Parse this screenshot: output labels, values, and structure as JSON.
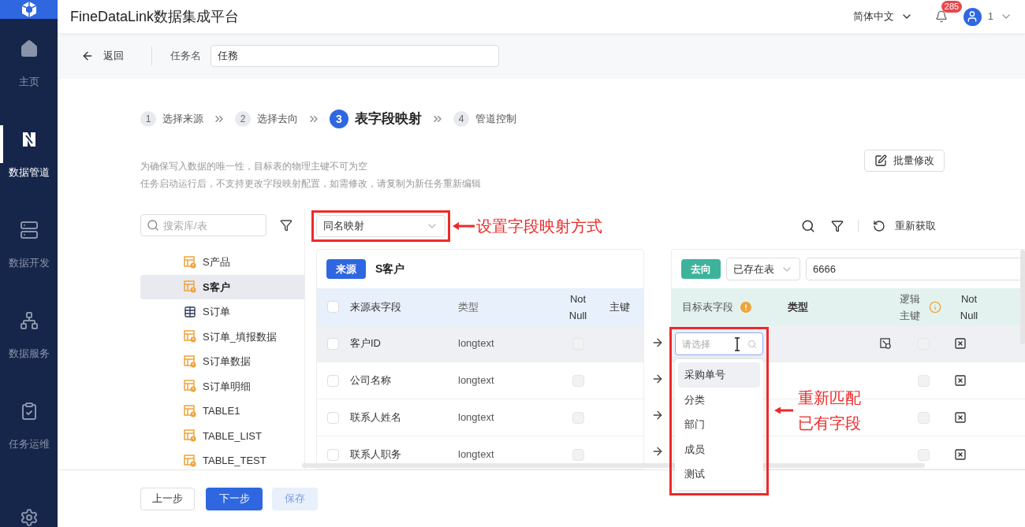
{
  "app": {
    "title": "FineDataLink数据集成平台"
  },
  "nav": [
    {
      "label": "主页",
      "selected": false,
      "kind": "home"
    },
    {
      "label": "数据管道",
      "selected": true,
      "kind": "pipeline"
    },
    {
      "label": "数据开发",
      "selected": false,
      "kind": "dev"
    },
    {
      "label": "数据服务",
      "selected": false,
      "kind": "service"
    },
    {
      "label": "任务运维",
      "selected": false,
      "kind": "ops"
    },
    {
      "selected": false,
      "kind": "settings"
    }
  ],
  "header": {
    "language": "简体中文",
    "notifications": "285",
    "user": "1"
  },
  "task": {
    "back": "返回",
    "name_label": "任务名",
    "name_value": "任務"
  },
  "steps": [
    {
      "number": "1",
      "label": "选择来源",
      "selected": false
    },
    {
      "number": "2",
      "label": "选择去向",
      "selected": false
    },
    {
      "number": "3",
      "label": "表字段映射",
      "selected": true
    },
    {
      "number": "4",
      "label": "管道控制",
      "selected": false
    }
  ],
  "notes": [
    "为确保写入数据的唯一性，目标表的物理主键不可为空",
    "任务启动运行后，不支持更改字段映射配置，如需修改，请复制为新任务重新编辑"
  ],
  "batch_edit": "批量修改",
  "tree": {
    "search_placeholder": "搜索库/表",
    "items": [
      {
        "label": "S产品",
        "selected": false,
        "kind": "warn-table"
      },
      {
        "label": "S客户",
        "selected": true,
        "kind": "warn-table"
      },
      {
        "label": "S订单",
        "selected": false,
        "kind": "table"
      },
      {
        "label": "S订单_填报数据",
        "selected": false,
        "kind": "warn-table"
      },
      {
        "label": "S订单数据",
        "selected": false,
        "kind": "warn-table"
      },
      {
        "label": "S订单明细",
        "selected": false,
        "kind": "warn-table"
      },
      {
        "label": "TABLE1",
        "selected": false,
        "kind": "warn-table"
      },
      {
        "label": "TABLE_LIST",
        "selected": false,
        "kind": "warn-table"
      },
      {
        "label": "TABLE_TEST",
        "selected": false,
        "kind": "warn-table"
      }
    ]
  },
  "mapping": {
    "value": "同名映射"
  },
  "toolbar": {
    "refetch": "重新获取"
  },
  "source": {
    "tag": "来源",
    "name": "S客户",
    "select_all": {
      "checked": false
    },
    "columns": [
      "来源表字段",
      "类型",
      "Not Null",
      "主键"
    ],
    "rows": [
      {
        "field": "客户ID",
        "type": "longtext",
        "hovered": true,
        "checked": false
      },
      {
        "field": "公司名称",
        "type": "longtext",
        "hovered": false,
        "checked": false
      },
      {
        "field": "联系人姓名",
        "type": "longtext",
        "hovered": false,
        "checked": false
      },
      {
        "field": "联系人职务",
        "type": "longtext",
        "hovered": false,
        "checked": false
      }
    ]
  },
  "target": {
    "tag": "去向",
    "mode": "已存在表",
    "table": "6666",
    "columns": [
      "目标表字段",
      "类型",
      "逻辑主键",
      "Not Null"
    ],
    "rows": [
      {
        "logical_key": true,
        "hovered": true
      },
      {
        "logical_key": false,
        "hovered": false
      },
      {
        "logical_key": false,
        "hovered": false
      },
      {
        "logical_key": false,
        "hovered": false
      }
    ]
  },
  "dropdown": {
    "placeholder": "请选择",
    "options": [
      {
        "label": "采购单号",
        "selected": true
      },
      {
        "label": "分类",
        "selected": false
      },
      {
        "label": "部门",
        "selected": false
      },
      {
        "label": "成员",
        "selected": false
      },
      {
        "label": "测试",
        "selected": false
      }
    ]
  },
  "annotations": {
    "mapping": "设置字段映射方式",
    "dropdown": [
      "重新匹配",
      "已有字段"
    ]
  },
  "footer": {
    "prev": "上一步",
    "next": "下一步",
    "save": "保存"
  }
}
